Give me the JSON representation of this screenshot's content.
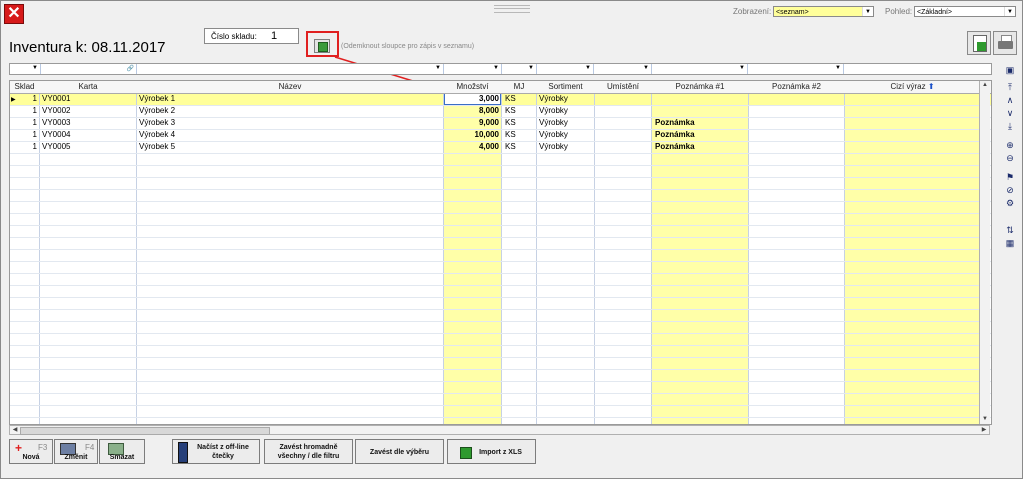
{
  "window": {
    "close_icon": "close-icon"
  },
  "header": {
    "title": "Inventura k: 08.11.2017",
    "sklad_label": "Číslo skladu:",
    "sklad_value": "1",
    "hint": "(Odemknout sloupce pro zápis v seznamu)",
    "zobrazeni_label": "Zobrazení:",
    "zobrazeni_value": "<seznam>",
    "pohled_label": "Pohled:",
    "pohled_value": "<Základní>"
  },
  "grid": {
    "columns": [
      "Sklad",
      "Karta",
      "Název",
      "Množství",
      "MJ",
      "Sortiment",
      "Umístění",
      "Poznámka #1",
      "Poznámka #2",
      "Cizí výraz"
    ],
    "rows": [
      {
        "sklad": "1",
        "karta": "VY0001",
        "nazev": "Výrobek 1",
        "mnozstvi": "3,000",
        "mj": "KS",
        "sortiment": "Výrobky",
        "umisteni": "",
        "poznamka1": "",
        "poznamka2": ""
      },
      {
        "sklad": "1",
        "karta": "VY0002",
        "nazev": "Výrobek 2",
        "mnozstvi": "8,000",
        "mj": "KS",
        "sortiment": "Výrobky",
        "umisteni": "",
        "poznamka1": "",
        "poznamka2": ""
      },
      {
        "sklad": "1",
        "karta": "VY0003",
        "nazev": "Výrobek 3",
        "mnozstvi": "9,000",
        "mj": "KS",
        "sortiment": "Výrobky",
        "umisteni": "",
        "poznamka1": "Poznámka",
        "poznamka2": ""
      },
      {
        "sklad": "1",
        "karta": "VY0004",
        "nazev": "Výrobek 4",
        "mnozstvi": "10,000",
        "mj": "KS",
        "sortiment": "Výrobky",
        "umisteni": "",
        "poznamka1": "Poznámka",
        "poznamka2": ""
      },
      {
        "sklad": "1",
        "karta": "VY0005",
        "nazev": "Výrobek 5",
        "mnozstvi": "4,000",
        "mj": "KS",
        "sortiment": "Výrobky",
        "umisteni": "",
        "poznamka1": "Poznámka",
        "poznamka2": ""
      }
    ]
  },
  "buttons": {
    "nova": "Nová",
    "nova_key": "F3",
    "zmenit": "Změnit",
    "zmenit_key": "F4",
    "smazat": "Smazat",
    "nacist": "Načíst z off-line čtečky",
    "zavest_hromadne": "Zavést hromadně všechny / dle filtru",
    "zavest_vyber": "Zavést dle výběru",
    "import": "Import z XLS"
  },
  "colors": {
    "highlight_red": "#e02020",
    "editable_yellow": "#ffffa8",
    "selected_row": "#ffff9a"
  }
}
